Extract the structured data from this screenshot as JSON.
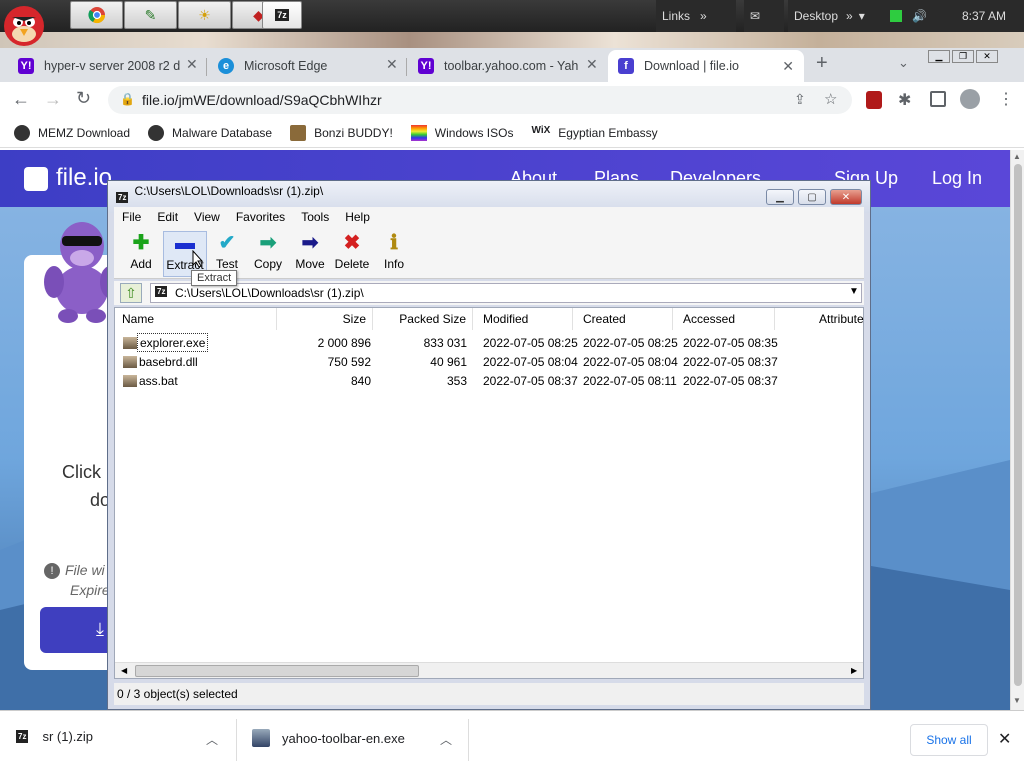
{
  "taskbar": {
    "links_label": "Links",
    "desktop_label": "Desktop",
    "clock": "8:37 AM"
  },
  "tabs": [
    {
      "title": "hyper-v server 2008 r2 d",
      "favicon": "Y!"
    },
    {
      "title": "Microsoft Edge",
      "favicon": "e"
    },
    {
      "title": "toolbar.yahoo.com - Yah",
      "favicon": "Y!"
    },
    {
      "title": "Download | file.io",
      "favicon": "f"
    }
  ],
  "address": {
    "url": "file.io/jmWE/download/S9aQCbhWIhzr"
  },
  "bookmarks": [
    {
      "label": "MEMZ Download",
      "color": "#333333"
    },
    {
      "label": "Malware Database",
      "color": "#333333"
    },
    {
      "label": "Bonzi BUDDY!",
      "color": "#7a5a2a"
    },
    {
      "label": "Windows ISOs",
      "color": "#cc3333"
    },
    {
      "label": "Egyptian Embassy",
      "color": "#222222"
    }
  ],
  "fileio": {
    "logo": "file.io",
    "nav": [
      "About",
      "Plans",
      "Developers",
      "Sign Up",
      "Log In"
    ],
    "click_text": "Click",
    "do_text": "do",
    "file_will": "File wi",
    "expire": "Expire"
  },
  "zip": {
    "title": "C:\\Users\\LOL\\Downloads\\sr (1).zip\\",
    "menu": [
      "File",
      "Edit",
      "View",
      "Favorites",
      "Tools",
      "Help"
    ],
    "tools": [
      {
        "label": "Add",
        "glyph": "✚",
        "color": "#1aa31a"
      },
      {
        "label": "Extract",
        "glyph": "▬",
        "color": "#1a2fd0"
      },
      {
        "label": "Test",
        "glyph": "✔",
        "color": "#23a9c8"
      },
      {
        "label": "Copy",
        "glyph": "➡",
        "color": "#1aa07a"
      },
      {
        "label": "Move",
        "glyph": "➡",
        "color": "#1a1a8a"
      },
      {
        "label": "Delete",
        "glyph": "✖",
        "color": "#d42020"
      },
      {
        "label": "Info",
        "glyph": "ℹ",
        "color": "#b08a10"
      }
    ],
    "path": "C:\\Users\\LOL\\Downloads\\sr (1).zip\\",
    "columns": [
      "Name",
      "Size",
      "Packed Size",
      "Modified",
      "Created",
      "Accessed",
      "Attribute"
    ],
    "rows": [
      {
        "name": "explorer.exe",
        "size": "2 000 896",
        "packed": "833 031",
        "modified": "2022-07-05 08:25",
        "created": "2022-07-05 08:25",
        "accessed": "2022-07-05 08:35"
      },
      {
        "name": "basebrd.dll",
        "size": "750 592",
        "packed": "40 961",
        "modified": "2022-07-05 08:04",
        "created": "2022-07-05 08:04",
        "accessed": "2022-07-05 08:37"
      },
      {
        "name": "ass.bat",
        "size": "840",
        "packed": "353",
        "modified": "2022-07-05 08:37",
        "created": "2022-07-05 08:11",
        "accessed": "2022-07-05 08:37"
      }
    ],
    "status": "0 / 3 object(s) selected",
    "tooltip": "Extract"
  },
  "downloads": {
    "items": [
      {
        "name": "sr (1).zip"
      },
      {
        "name": "yahoo-toolbar-en.exe"
      }
    ],
    "show_all": "Show all"
  }
}
